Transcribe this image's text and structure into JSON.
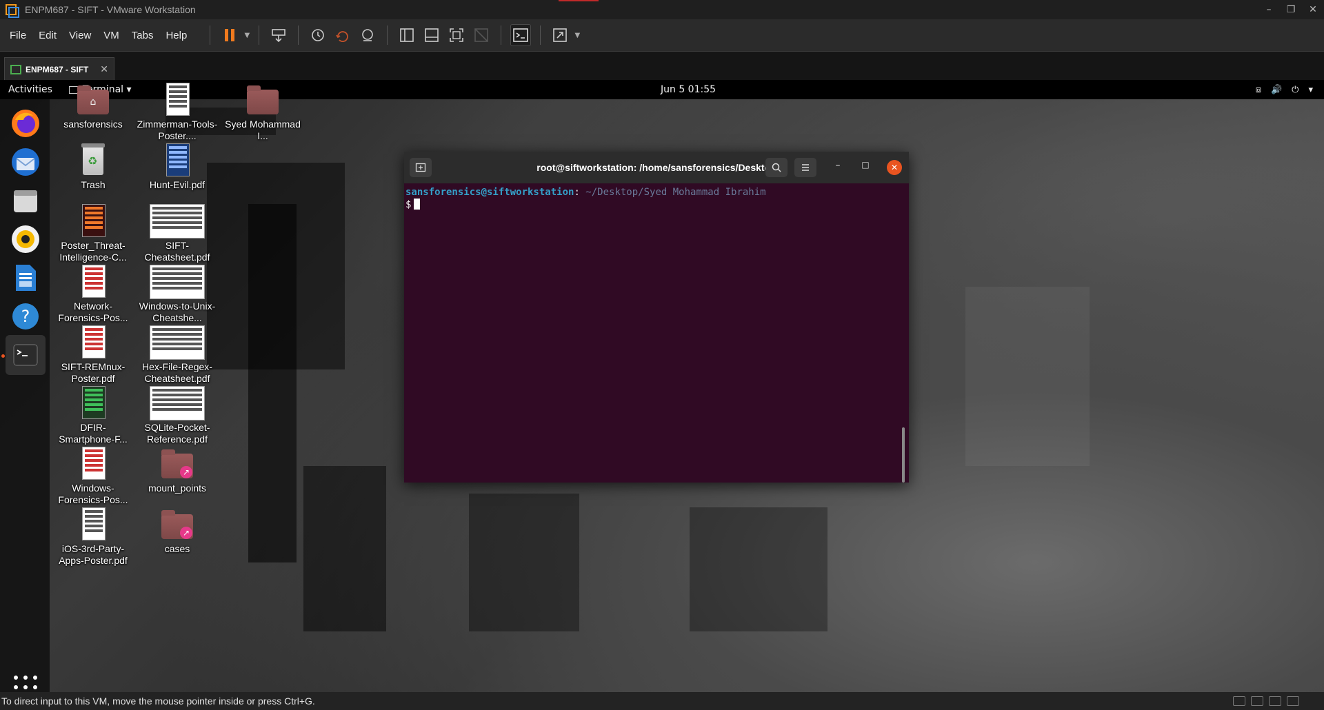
{
  "window": {
    "title": "ENPM687 - SIFT - VMware Workstation",
    "controls": [
      "–",
      "❐",
      "✕"
    ]
  },
  "menubar": {
    "items": [
      "File",
      "Edit",
      "View",
      "VM",
      "Tabs",
      "Help"
    ]
  },
  "vm_tab": {
    "label": "ENPM687 - SIFT",
    "close": "✕"
  },
  "gnome": {
    "activities": "Activities",
    "app_menu": "Terminal ▾",
    "clock": "Jun 5  01:55",
    "tray": [
      "⧈",
      "🔊",
      "⏻",
      "▾"
    ]
  },
  "desktop": {
    "icons": [
      {
        "label": "sansforensics",
        "type": "home-folder"
      },
      {
        "label": "Zimmerman-Tools-Poster....",
        "type": "pdf"
      },
      {
        "label": "Syed Mohammad I...",
        "type": "folder"
      },
      {
        "label": "Trash",
        "type": "trash"
      },
      {
        "label": "Hunt-Evil.pdf",
        "type": "pdf"
      },
      {
        "label": "Poster_Threat-Intelligence-C...",
        "type": "pdf"
      },
      {
        "label": "SIFT-Cheatsheet.pdf",
        "type": "pdf"
      },
      {
        "label": "Network-Forensics-Pos...",
        "type": "pdf"
      },
      {
        "label": "Windows-to-Unix-Cheatshe...",
        "type": "pdf"
      },
      {
        "label": "SIFT-REMnux-Poster.pdf",
        "type": "pdf"
      },
      {
        "label": "Hex-File-Regex-Cheatsheet.pdf",
        "type": "pdf"
      },
      {
        "label": "DFIR-Smartphone-F...",
        "type": "pdf"
      },
      {
        "label": "SQLite-Pocket-Reference.pdf",
        "type": "pdf"
      },
      {
        "label": "Windows-Forensics-Pos...",
        "type": "pdf"
      },
      {
        "label": "mount_points",
        "type": "link-folder"
      },
      {
        "label": "iOS-3rd-Party-Apps-Poster.pdf",
        "type": "pdf"
      },
      {
        "label": "cases",
        "type": "link-folder"
      }
    ]
  },
  "terminal": {
    "title": "root@siftworkstation: /home/sansforensics/Desktop",
    "prompt_user": "sansforensics@siftworkstation",
    "prompt_sep": ":",
    "prompt_path": " ~/Desktop/Syed Mohammad Ibrahim",
    "prompt_symbol": "$"
  },
  "statusbar": {
    "hint": "To direct input to this VM, move the mouse pointer inside or press Ctrl+G."
  },
  "colors": {
    "terminal_bg": "#300a24",
    "ubuntu_orange": "#e95420",
    "prompt_user": "#34a0c9"
  }
}
